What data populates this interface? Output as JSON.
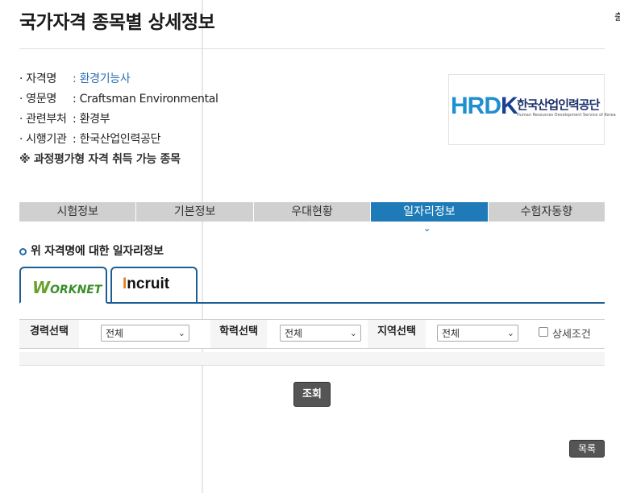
{
  "page": {
    "title": "국가자격 종목별 상세정보",
    "edge_char": "출"
  },
  "info": {
    "rows": [
      {
        "label": "· 자격명",
        "value": ": 환경기능사"
      },
      {
        "label": "· 영문명",
        "value": ": Craftsman Environmental"
      },
      {
        "label": "· 관련부처",
        "value": ": 환경부"
      },
      {
        "label": "· 시행기관",
        "value": ": 한국산업인력공단"
      }
    ],
    "note": "※ 과정평가형 자격 취득 가능 종목"
  },
  "logo": {
    "mark_prefix": "HRD",
    "mark_suffix": "K",
    "name_kr": "한국산업인력공단",
    "name_en": "Human Resources Development Service of Korea"
  },
  "tabs": [
    {
      "label": "시험정보",
      "active": false
    },
    {
      "label": "기본정보",
      "active": false
    },
    {
      "label": "우대현황",
      "active": false
    },
    {
      "label": "일자리정보",
      "active": true
    },
    {
      "label": "수험자동향",
      "active": false
    }
  ],
  "section": {
    "title": "위 자격명에 대한 일자리정보"
  },
  "subtabs": {
    "worknet": {
      "first": "W",
      "rest": "ORKNET"
    },
    "incruit": {
      "first": "I",
      "rest": "ncruit"
    }
  },
  "filters": {
    "career_label": "경력선택",
    "career_value": "전체",
    "education_label": "학력선택",
    "education_value": "전체",
    "region_label": "지역선택",
    "region_value": "전체",
    "detail_label": "상세조건"
  },
  "buttons": {
    "search": "조회",
    "list": "목록"
  },
  "colors": {
    "active_tab": "#1e7bb8",
    "tab_bg": "#d0d0d0",
    "link": "#2a6fb0",
    "button": "#555555"
  }
}
